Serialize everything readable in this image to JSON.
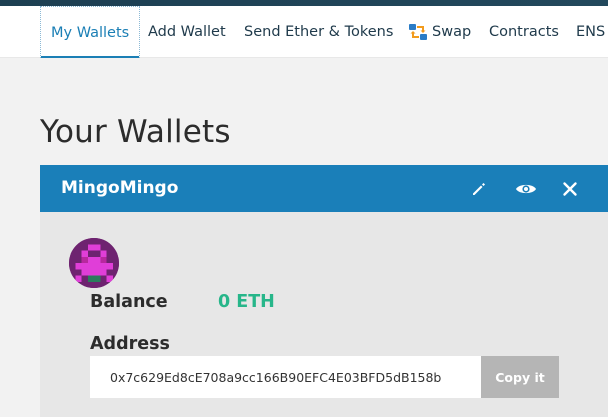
{
  "nav": {
    "items": [
      {
        "label": "My Wallets",
        "active": true
      },
      {
        "label": "Add Wallet"
      },
      {
        "label": "Send Ether & Tokens"
      },
      {
        "label": "Swap",
        "icon": "swap-icon"
      },
      {
        "label": "Contracts"
      },
      {
        "label": "ENS"
      }
    ]
  },
  "page": {
    "title": "Your Wallets"
  },
  "wallet": {
    "name": "MingoMingo",
    "header_icons": [
      "edit-icon",
      "eye-icon",
      "close-icon"
    ],
    "balance_label": "Balance",
    "balance_value": "0 ETH",
    "address_label": "Address",
    "address": "0x7c629Ed8cE708a9cc166B90EFC4E03BFD5dB158b",
    "copy_label": "Copy it"
  },
  "colors": {
    "header_bg": "#1a7fb9",
    "accent": "#1b7fb5",
    "balance": "#27b68a",
    "copy_button": "#b5b5b5"
  }
}
